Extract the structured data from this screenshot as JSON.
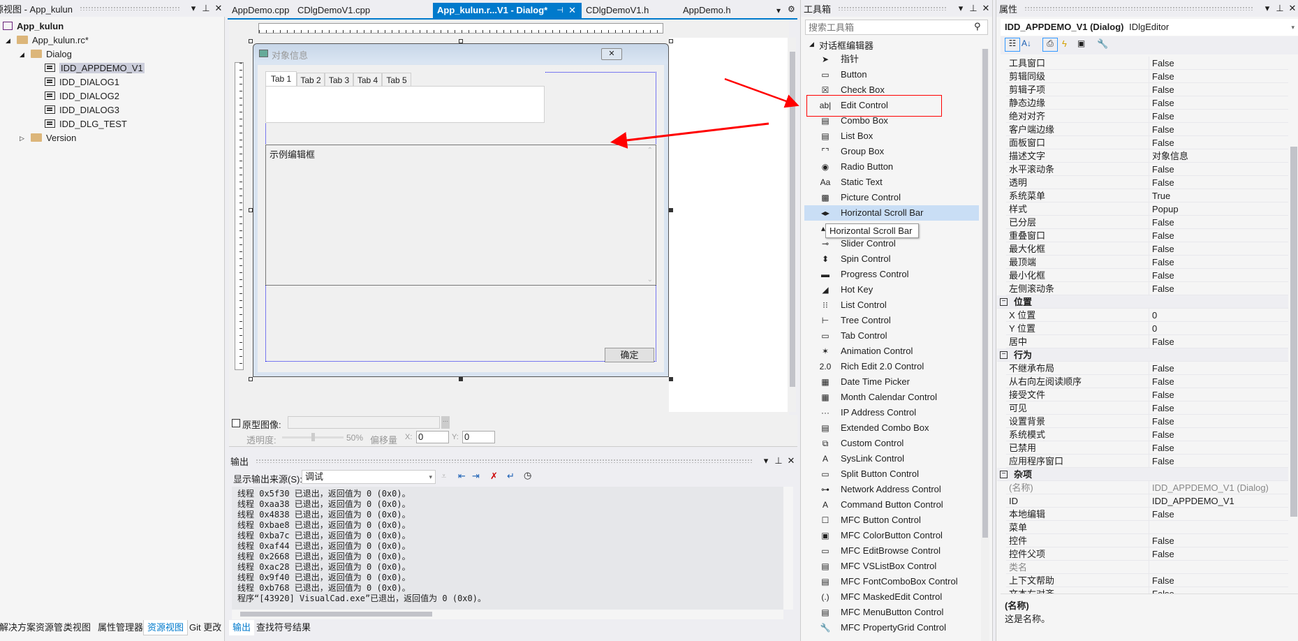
{
  "left_panel": {
    "title": "源视图 - App_kulun",
    "tree": [
      {
        "label": "App_kulun",
        "level": 0,
        "icon": "project-icon",
        "bold": true
      },
      {
        "label": "App_kulun.rc*",
        "level": 1,
        "icon": "folder-icon",
        "expander": "expanded"
      },
      {
        "label": "Dialog",
        "level": 2,
        "icon": "folder-icon",
        "expander": "expanded"
      },
      {
        "label": "IDD_APPDEMO_V1",
        "level": 3,
        "icon": "dialog-icon",
        "selected": true
      },
      {
        "label": "IDD_DIALOG1",
        "level": 3,
        "icon": "dialog-icon"
      },
      {
        "label": "IDD_DIALOG2",
        "level": 3,
        "icon": "dialog-icon"
      },
      {
        "label": "IDD_DIALOG3",
        "level": 3,
        "icon": "dialog-icon"
      },
      {
        "label": "IDD_DLG_TEST",
        "level": 3,
        "icon": "dialog-icon"
      },
      {
        "label": "Version",
        "level": 2,
        "icon": "folder-icon",
        "expander": "collapsed"
      }
    ],
    "bottom_tabs": [
      {
        "label": "解决方案资源管...",
        "active": false
      },
      {
        "label": "类视图",
        "active": false
      },
      {
        "label": "属性管理器",
        "active": false
      },
      {
        "label": "资源视图",
        "active": true
      },
      {
        "label": "Git 更改",
        "active": false
      }
    ]
  },
  "doc_tabs": [
    {
      "label": "AppDemo.cpp",
      "active": false
    },
    {
      "label": "CDlgDemoV1.cpp",
      "active": false
    },
    {
      "label": "App_kulun.r...V1 - Dialog*",
      "active": true
    },
    {
      "label": "CDlgDemoV1.h",
      "active": false
    },
    {
      "label": "AppDemo.h",
      "active": false
    }
  ],
  "dialog": {
    "title": "对象信息",
    "tabs": [
      "Tab 1",
      "Tab 2",
      "Tab 3",
      "Tab 4",
      "Tab 5"
    ],
    "edit_text": "示例编辑框",
    "ok_label": "确定"
  },
  "prototype": {
    "checkbox_label": "原型图像:",
    "browse_label": "...",
    "opacity_label": "透明度:",
    "opacity_value": "50%",
    "opacity_percent": 50,
    "offset_label": "偏移量",
    "x_label": "X:",
    "x_value": "0",
    "y_label": "Y:",
    "y_value": "0"
  },
  "output": {
    "title": "输出",
    "source_label": "显示输出来源(S):",
    "source_value": "调试",
    "lines": [
      "线程 0x5f30 已退出，返回值为 0 (0x0)。",
      "线程 0xaa38 已退出，返回值为 0 (0x0)。",
      "线程 0x4838 已退出，返回值为 0 (0x0)。",
      "线程 0xbae8 已退出，返回值为 0 (0x0)。",
      "线程 0xba7c 已退出，返回值为 0 (0x0)。",
      "线程 0xaf44 已退出，返回值为 0 (0x0)。",
      "线程 0x2668 已退出，返回值为 0 (0x0)。",
      "线程 0xac28 已退出，返回值为 0 (0x0)。",
      "线程 0x9f40 已退出，返回值为 0 (0x0)。",
      "线程 0xb768 已退出，返回值为 0 (0x0)。",
      "程序“[43920] VisualCad.exe”已退出，返回值为 0 (0x0)。"
    ],
    "bottom_tabs": [
      {
        "label": "输出",
        "active": true
      },
      {
        "label": "查找符号结果",
        "active": false
      }
    ]
  },
  "toolbox": {
    "title": "工具箱",
    "search_placeholder": "搜索工具箱",
    "category": "对话框编辑器",
    "items": [
      {
        "label": "指针",
        "icon": "pointer-icon",
        "glyph": "➤"
      },
      {
        "label": "Button",
        "icon": "button-icon",
        "glyph": "▭"
      },
      {
        "label": "Check Box",
        "icon": "checkbox-icon",
        "glyph": "☒"
      },
      {
        "label": "Edit Control",
        "icon": "edit-control-icon",
        "glyph": "ab|",
        "boxed": true
      },
      {
        "label": "Combo Box",
        "icon": "combo-box-icon",
        "glyph": "▤"
      },
      {
        "label": "List Box",
        "icon": "list-box-icon",
        "glyph": "▤"
      },
      {
        "label": "Group Box",
        "icon": "group-box-icon",
        "glyph": "⌜⌝"
      },
      {
        "label": "Radio Button",
        "icon": "radio-button-icon",
        "glyph": "◉"
      },
      {
        "label": "Static Text",
        "icon": "static-text-icon",
        "glyph": "Aa"
      },
      {
        "label": "Picture Control",
        "icon": "picture-control-icon",
        "glyph": "▩"
      },
      {
        "label": "Horizontal Scroll Bar",
        "icon": "hscroll-icon",
        "glyph": "◂▸",
        "highlighted": true
      },
      {
        "label": "",
        "icon": "vscroll-icon",
        "glyph": "▴▾"
      },
      {
        "label": "Slider Control",
        "icon": "slider-icon",
        "glyph": "⊸"
      },
      {
        "label": "Spin Control",
        "icon": "spin-icon",
        "glyph": "⬍"
      },
      {
        "label": "Progress Control",
        "icon": "progress-icon",
        "glyph": "▬"
      },
      {
        "label": "Hot Key",
        "icon": "hotkey-icon",
        "glyph": "◢"
      },
      {
        "label": "List Control",
        "icon": "list-control-icon",
        "glyph": "⁝⁝"
      },
      {
        "label": "Tree Control",
        "icon": "tree-control-icon",
        "glyph": "⊢"
      },
      {
        "label": "Tab Control",
        "icon": "tab-control-icon",
        "glyph": "▭"
      },
      {
        "label": "Animation Control",
        "icon": "animation-icon",
        "glyph": "✶"
      },
      {
        "label": "Rich Edit 2.0 Control",
        "icon": "rich-edit-icon",
        "glyph": "2.0"
      },
      {
        "label": "Date Time Picker",
        "icon": "date-time-icon",
        "glyph": "▦"
      },
      {
        "label": "Month Calendar Control",
        "icon": "calendar-icon",
        "glyph": "▦"
      },
      {
        "label": "IP Address Control",
        "icon": "ip-address-icon",
        "glyph": "···"
      },
      {
        "label": "Extended Combo Box",
        "icon": "ext-combo-icon",
        "glyph": "▤"
      },
      {
        "label": "Custom Control",
        "icon": "custom-control-icon",
        "glyph": "⧉"
      },
      {
        "label": "SysLink Control",
        "icon": "syslink-icon",
        "glyph": "A"
      },
      {
        "label": "Split Button Control",
        "icon": "split-button-icon",
        "glyph": "▭"
      },
      {
        "label": "Network Address Control",
        "icon": "network-address-icon",
        "glyph": "⊶"
      },
      {
        "label": "Command Button Control",
        "icon": "command-button-icon",
        "glyph": "A"
      },
      {
        "label": "MFC Button Control",
        "icon": "mfc-button-icon",
        "glyph": "☐"
      },
      {
        "label": "MFC ColorButton Control",
        "icon": "mfc-colorbutton-icon",
        "glyph": "▣"
      },
      {
        "label": "MFC EditBrowse Control",
        "icon": "mfc-editbrowse-icon",
        "glyph": "▭"
      },
      {
        "label": "MFC VSListBox Control",
        "icon": "mfc-vslistbox-icon",
        "glyph": "▤"
      },
      {
        "label": "MFC FontComboBox Control",
        "icon": "mfc-fontcombo-icon",
        "glyph": "▤"
      },
      {
        "label": "MFC MaskedEdit Control",
        "icon": "mfc-maskededit-icon",
        "glyph": "(.)"
      },
      {
        "label": "MFC MenuButton Control",
        "icon": "mfc-menubutton-icon",
        "glyph": "▤"
      },
      {
        "label": "MFC PropertyGrid Control",
        "icon": "mfc-propertygrid-icon",
        "glyph": "🔧"
      }
    ],
    "tooltip": "Horizontal Scroll Bar"
  },
  "properties": {
    "title": "属性",
    "object_name": "IDD_APPDEMO_V1 (Dialog)",
    "object_type": "IDlgEditor",
    "rows": [
      {
        "name": "工具窗口",
        "value": "False"
      },
      {
        "name": "剪辑同级",
        "value": "False"
      },
      {
        "name": "剪辑子项",
        "value": "False"
      },
      {
        "name": "静态边缘",
        "value": "False"
      },
      {
        "name": "绝对对齐",
        "value": "False"
      },
      {
        "name": "客户端边缘",
        "value": "False"
      },
      {
        "name": "面板窗口",
        "value": "False"
      },
      {
        "name": "描述文字",
        "value": "对象信息"
      },
      {
        "name": "水平滚动条",
        "value": "False"
      },
      {
        "name": "透明",
        "value": "False"
      },
      {
        "name": "系统菜单",
        "value": "True"
      },
      {
        "name": "样式",
        "value": "Popup"
      },
      {
        "name": "已分层",
        "value": "False"
      },
      {
        "name": "重叠窗口",
        "value": "False"
      },
      {
        "name": "最大化框",
        "value": "False"
      },
      {
        "name": "最顶端",
        "value": "False"
      },
      {
        "name": "最小化框",
        "value": "False"
      },
      {
        "name": "左侧滚动条",
        "value": "False"
      },
      {
        "name": "位置",
        "category": true
      },
      {
        "name": "X 位置",
        "value": "0"
      },
      {
        "name": "Y 位置",
        "value": "0"
      },
      {
        "name": "居中",
        "value": "False"
      },
      {
        "name": "行为",
        "category": true
      },
      {
        "name": "不继承布局",
        "value": "False"
      },
      {
        "name": "从右向左阅读顺序",
        "value": "False"
      },
      {
        "name": "接受文件",
        "value": "False"
      },
      {
        "name": "可见",
        "value": "False"
      },
      {
        "name": "设置背景",
        "value": "False"
      },
      {
        "name": "系统模式",
        "value": "False"
      },
      {
        "name": "已禁用",
        "value": "False"
      },
      {
        "name": "应用程序窗口",
        "value": "False"
      },
      {
        "name": "杂项",
        "category": true
      },
      {
        "name": "(名称)",
        "value": "IDD_APPDEMO_V1 (Dialog)",
        "readonly": true
      },
      {
        "name": "ID",
        "value": "IDD_APPDEMO_V1"
      },
      {
        "name": "本地编辑",
        "value": "False"
      },
      {
        "name": "菜单",
        "value": ""
      },
      {
        "name": "控件",
        "value": "False"
      },
      {
        "name": "控件父项",
        "value": "False"
      },
      {
        "name": "类名",
        "value": "",
        "readonly": true
      },
      {
        "name": "上下文帮助",
        "value": "False"
      },
      {
        "name": "文本右对齐",
        "value": "False"
      }
    ],
    "description_title": "(名称)",
    "description_text": "这是名称。"
  },
  "colors": {
    "accent": "#007acc",
    "annotation_red": "#ff0000",
    "highlight": "#c9def5",
    "selection": "#cccedb"
  }
}
